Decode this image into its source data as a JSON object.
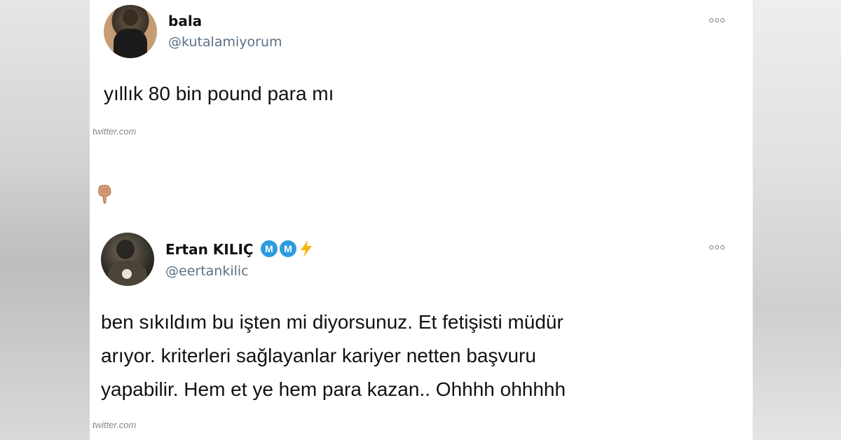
{
  "tweets": [
    {
      "name": "bala",
      "handle": "@kutalamiyorum",
      "text": "yıllık 80 bin pound para mı",
      "source": "twitter.com"
    },
    {
      "name": "Ertan KILIÇ",
      "badges": [
        "M",
        "M"
      ],
      "handle": "@eertankilic",
      "text_lines": [
        "ben sıkıldım bu işten mi diyorsunuz. Et fetişisti müdür",
        "arıyor. kriterleri sağlayanlar kariyer netten başvuru",
        "yapabilir. Hem et ye hem para kazan.. Ohhhh ohhhhh"
      ],
      "source": "twitter.com"
    }
  ],
  "icons": {
    "more": "more-options-icon",
    "pointer": "pointing-down-emoji-icon",
    "bolt": "lightning-bolt-icon"
  },
  "colors": {
    "badge": "#2d9be0",
    "handle": "#5b7083",
    "bolt": "#f5b50b"
  }
}
